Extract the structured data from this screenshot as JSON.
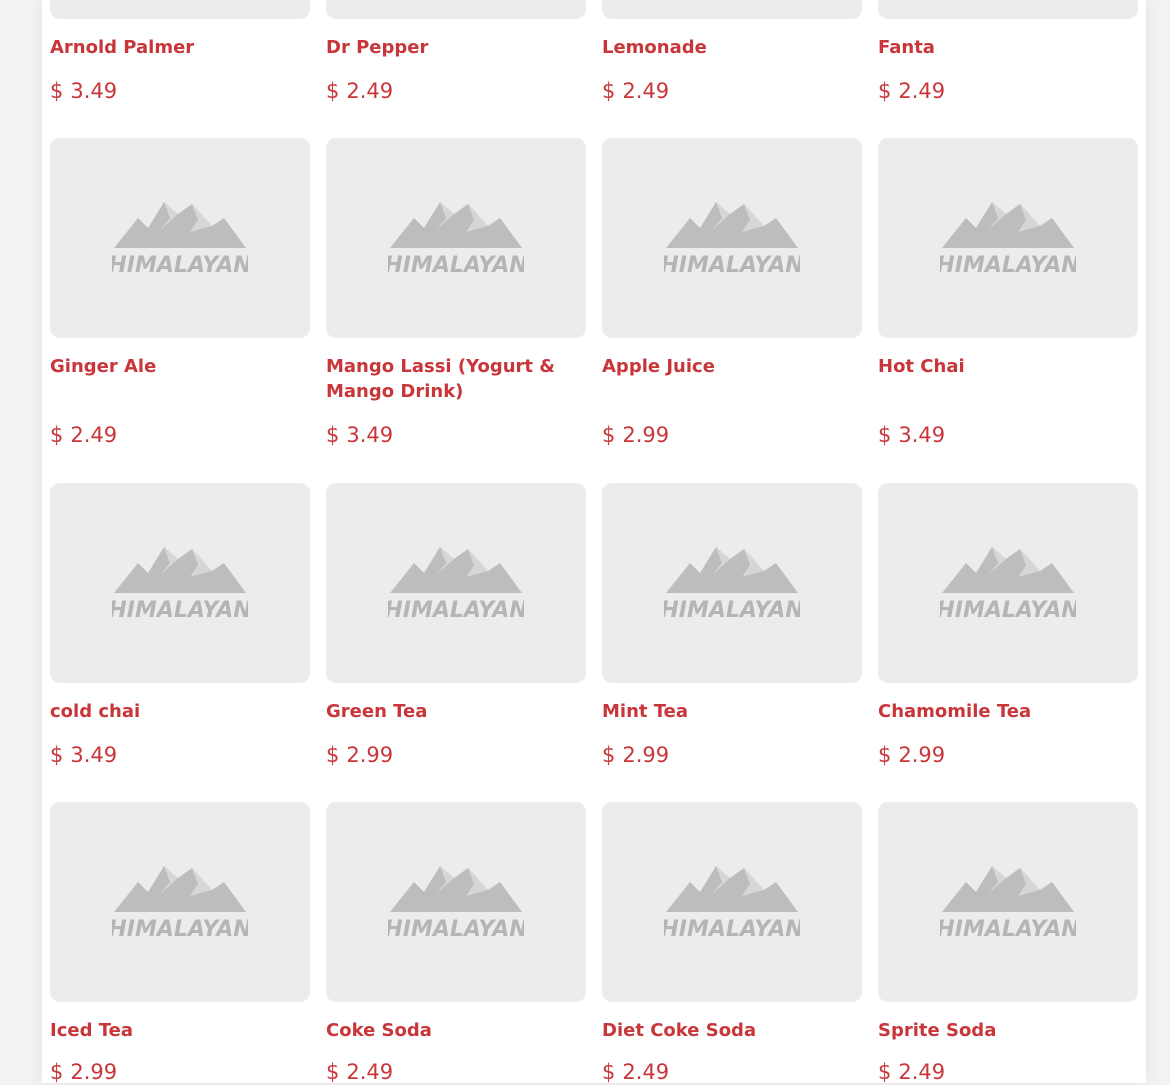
{
  "brand": {
    "logo_text": "HIMALAYAN"
  },
  "colors": {
    "accent": "#c8363a",
    "placeholder_bg": "#ececec",
    "logo_gray": "#b5b5b5"
  },
  "currency_symbol": "$",
  "rows": [
    [
      {
        "name": "Arnold Palmer",
        "price": "3.49"
      },
      {
        "name": "Dr Pepper",
        "price": "2.49"
      },
      {
        "name": "Lemonade",
        "price": "2.49"
      },
      {
        "name": "Fanta",
        "price": "2.49"
      }
    ],
    [
      {
        "name": "Ginger Ale",
        "price": "2.49"
      },
      {
        "name": "Mango Lassi (Yogurt & Mango Drink)",
        "price": "3.49"
      },
      {
        "name": "Apple Juice",
        "price": "2.99"
      },
      {
        "name": "Hot Chai",
        "price": "3.49"
      }
    ],
    [
      {
        "name": "cold chai",
        "price": "3.49"
      },
      {
        "name": "Green Tea",
        "price": "2.99"
      },
      {
        "name": "Mint Tea",
        "price": "2.99"
      },
      {
        "name": "Chamomile Tea",
        "price": "2.99"
      }
    ],
    [
      {
        "name": "Iced Tea",
        "price": "2.99"
      },
      {
        "name": "Coke Soda",
        "price": "2.49"
      },
      {
        "name": "Diet Coke Soda",
        "price": "2.49"
      },
      {
        "name": "Sprite Soda",
        "price": "2.49"
      }
    ]
  ]
}
